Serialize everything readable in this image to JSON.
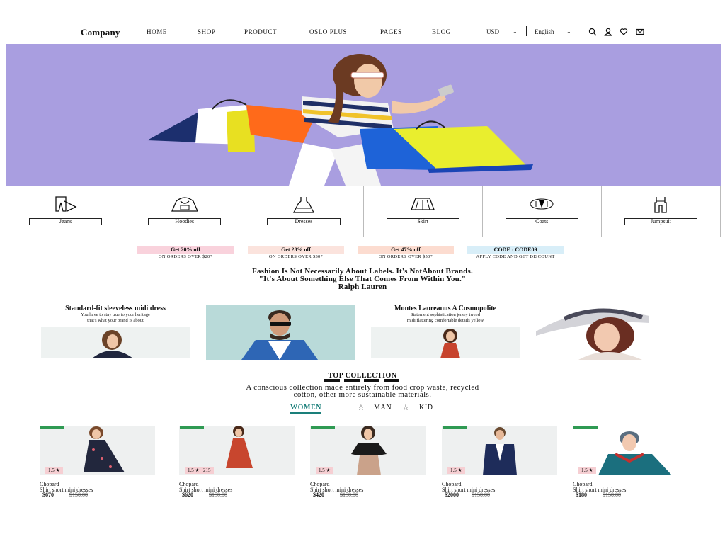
{
  "nav": {
    "logo": "Company",
    "items": [
      "HOME",
      "SHOP",
      "PRODUCT",
      "OSLO PLUS",
      "PAGES",
      "BLOG"
    ],
    "currency": "USD",
    "language": "English",
    "icons": [
      "search-icon",
      "user-icon",
      "heart-icon",
      "mail-icon"
    ]
  },
  "categories": [
    {
      "label": "Jeans",
      "icon": "jeans-icon"
    },
    {
      "label": "Hoodies",
      "icon": "hoodie-icon"
    },
    {
      "label": "Dresses",
      "icon": "dress-icon"
    },
    {
      "label": "Skirt",
      "icon": "skirt-icon"
    },
    {
      "label": "Coats",
      "icon": "coat-icon"
    },
    {
      "label": "Jumpsuit",
      "icon": "jumpsuit-icon"
    }
  ],
  "promos": [
    {
      "title": "Get 20% off",
      "sub": "ON ORDERS OVER $20*",
      "color": "#f9d2dc"
    },
    {
      "title": "Get 23% off",
      "sub": "ON ORDERS OVER $30*",
      "color": "#fbe3dd"
    },
    {
      "title": "Get 47% off",
      "sub": "ON ORDERS OVER $50*",
      "color": "#fcdcd0"
    },
    {
      "title": "CODE : CODE09",
      "sub": "APPLY CODE AND GET DISCOUNT",
      "color": "#d8eef8"
    }
  ],
  "quote": {
    "line1": "Fashion Is Not Necessarily About Labels. It's NotAbout Brands.",
    "line2": "\"It's About Something Else That Comes From Within You.\"",
    "author": "Ralph Lauren"
  },
  "features": [
    {
      "title": "Standard-fit sleeveless midi dress",
      "line1": "You have to stay true to your heritage",
      "line2": "that's what your brand is about"
    },
    {
      "title": "Montes Laoreanus A Cosmopolite",
      "line1": "Statement sophistication jersey tweed",
      "line2": "midi flattering comfortable details yellow"
    }
  ],
  "top_collection": {
    "title": "TOP COLLECTION",
    "desc1": "A conscious collection made entirely from food crop waste, recycled",
    "desc2": "cotton, other more sustainable materials.",
    "tabs": [
      "WOMEN",
      "MAN",
      "KID"
    ],
    "active_tab": "WOMEN"
  },
  "products": [
    {
      "brand": "Chopard",
      "name": "Shirt short mini dresses",
      "price": "$670",
      "old": "$150.00",
      "rating": "1.5",
      "extra": ""
    },
    {
      "brand": "Chopard",
      "name": "Shirt short mini dresses",
      "price": "$620",
      "old": "$150.00",
      "rating": "1.5",
      "extra": "215"
    },
    {
      "brand": "Chopard",
      "name": "Shirt short mini dresses",
      "price": "$420",
      "old": "$150.00",
      "rating": "1.5",
      "extra": ""
    },
    {
      "brand": "Chopard",
      "name": "Shirt short mini dresses",
      "price": "$2000",
      "old": "$150.00",
      "rating": "1.5",
      "extra": ""
    },
    {
      "brand": "Chopard",
      "name": "Shirt short mini dresses",
      "price": "$180",
      "old": "$150.00",
      "rating": "1.5",
      "extra": ""
    }
  ],
  "colors": {
    "hero_bg": "#a99ee0",
    "accent": "#1a7f7a",
    "badge": "#2f9a53"
  }
}
